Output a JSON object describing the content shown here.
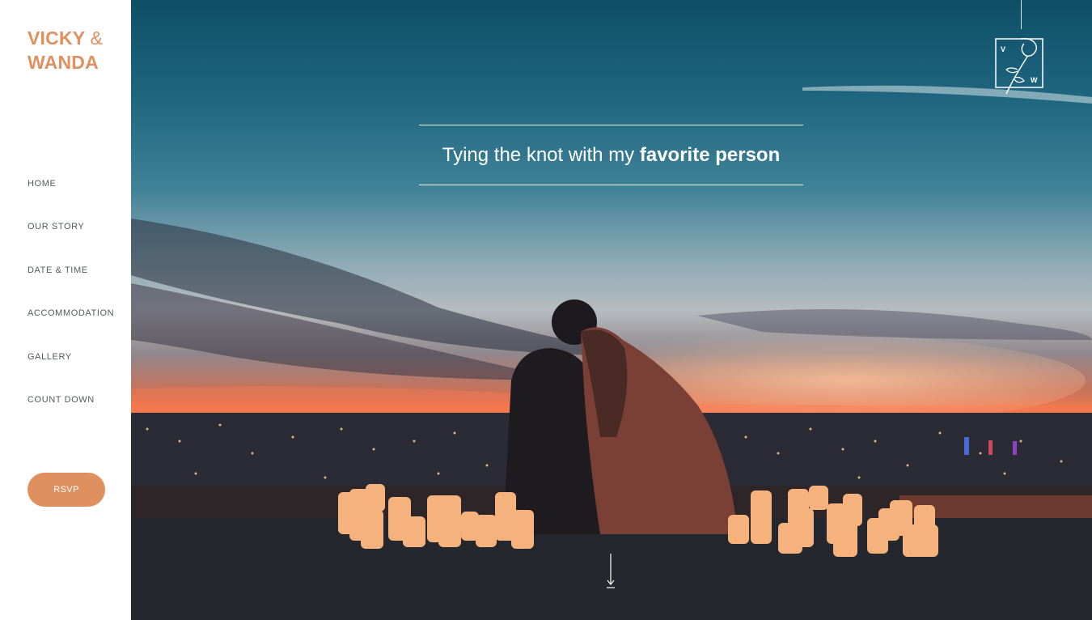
{
  "brand": {
    "line1": "VICKY",
    "amp": "&",
    "line2": "WANDA"
  },
  "nav": {
    "items": [
      {
        "label": "HOME"
      },
      {
        "label": "OUR STORY"
      },
      {
        "label": "DATE & TIME"
      },
      {
        "label": "ACCOMMODATION"
      },
      {
        "label": "GALLERY"
      },
      {
        "label": "COUNT DOWN"
      }
    ]
  },
  "rsvp": {
    "label": "RSVP"
  },
  "hero": {
    "tagline_regular": "Tying the knot with my ",
    "tagline_bold": "favorite person",
    "monogram": {
      "left": "V",
      "right": "W"
    }
  },
  "icons": {
    "logo": "rose-monogram-icon",
    "scroll": "arrow-down-icon"
  },
  "colors": {
    "accent": "#e0905f",
    "nav_text": "#555a5e"
  }
}
